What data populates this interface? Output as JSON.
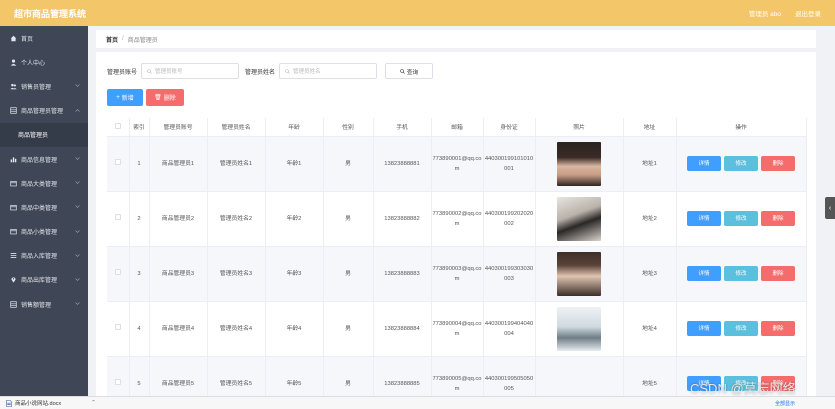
{
  "header": {
    "title": "超市商品管理系统",
    "user": "管理员 abo",
    "logout": "退出登录"
  },
  "sidebar": {
    "items": [
      {
        "label": "首页",
        "icon": "home-icon"
      },
      {
        "label": "个人中心",
        "icon": "user-icon"
      },
      {
        "label": "销售员管理",
        "icon": "users-icon"
      },
      {
        "label": "商品管理员管理",
        "icon": "grid-icon"
      },
      {
        "label": "商品管理员",
        "icon": "",
        "sub": true
      },
      {
        "label": "商品信息管理",
        "icon": "chart-icon"
      },
      {
        "label": "商品大类管理",
        "icon": "box-icon"
      },
      {
        "label": "商品中类管理",
        "icon": "box-icon"
      },
      {
        "label": "商品小类管理",
        "icon": "box-icon"
      },
      {
        "label": "商品入库管理",
        "icon": "list-icon"
      },
      {
        "label": "商品出库管理",
        "icon": "pin-icon"
      },
      {
        "label": "销售额管理",
        "icon": "grid-icon"
      }
    ]
  },
  "breadcrumb": {
    "home": "首页",
    "separator": "/",
    "current": "商品管理员"
  },
  "search": {
    "label1": "管理员账号",
    "placeholder1": "管理员账号",
    "label2": "管理员姓名",
    "placeholder2": "管理员姓名",
    "query": "查询"
  },
  "actions": {
    "add": "新增",
    "delete": "删除"
  },
  "table": {
    "headers": [
      "",
      "索引",
      "管理员账号",
      "管理员姓名",
      "年龄",
      "性别",
      "手机",
      "邮箱",
      "身份证",
      "照片",
      "地址",
      "操作"
    ],
    "rows": [
      {
        "idx": "1",
        "account": "商品管理员1",
        "name": "管理员姓名1",
        "age": "年龄1",
        "gender": "男",
        "phone": "13823888881",
        "email": "773890001@qq.com",
        "id": "440300199101010001",
        "addr": "地址1"
      },
      {
        "idx": "2",
        "account": "商品管理员2",
        "name": "管理员姓名2",
        "age": "年龄2",
        "gender": "男",
        "phone": "13823888882",
        "email": "773890002@qq.com",
        "id": "440300199202020002",
        "addr": "地址2"
      },
      {
        "idx": "3",
        "account": "商品管理员3",
        "name": "管理员姓名3",
        "age": "年龄3",
        "gender": "男",
        "phone": "13823888883",
        "email": "773890003@qq.com",
        "id": "440300199303030003",
        "addr": "地址3"
      },
      {
        "idx": "4",
        "account": "商品管理员4",
        "name": "管理员姓名4",
        "age": "年龄4",
        "gender": "男",
        "phone": "13823888884",
        "email": "773890004@qq.com",
        "id": "440300199404040004",
        "addr": "地址4"
      },
      {
        "idx": "5",
        "account": "商品管理员5",
        "name": "管理员姓名5",
        "age": "年龄5",
        "gender": "男",
        "phone": "13823888885",
        "email": "773890005@qq.com",
        "id": "440300199505050005",
        "addr": "地址5"
      }
    ],
    "ops": {
      "detail": "详情",
      "edit": "修改",
      "remove": "删除"
    }
  },
  "bottombar": {
    "file": "商品小说网站.docx",
    "show_all": "全部显示"
  },
  "watermark": "CSDN @莫忘网络",
  "colors": {
    "header": "#f3c66a",
    "sidebar": "#3f4756",
    "primary": "#409eff",
    "danger": "#f56c6c",
    "info": "#5bc0de"
  }
}
